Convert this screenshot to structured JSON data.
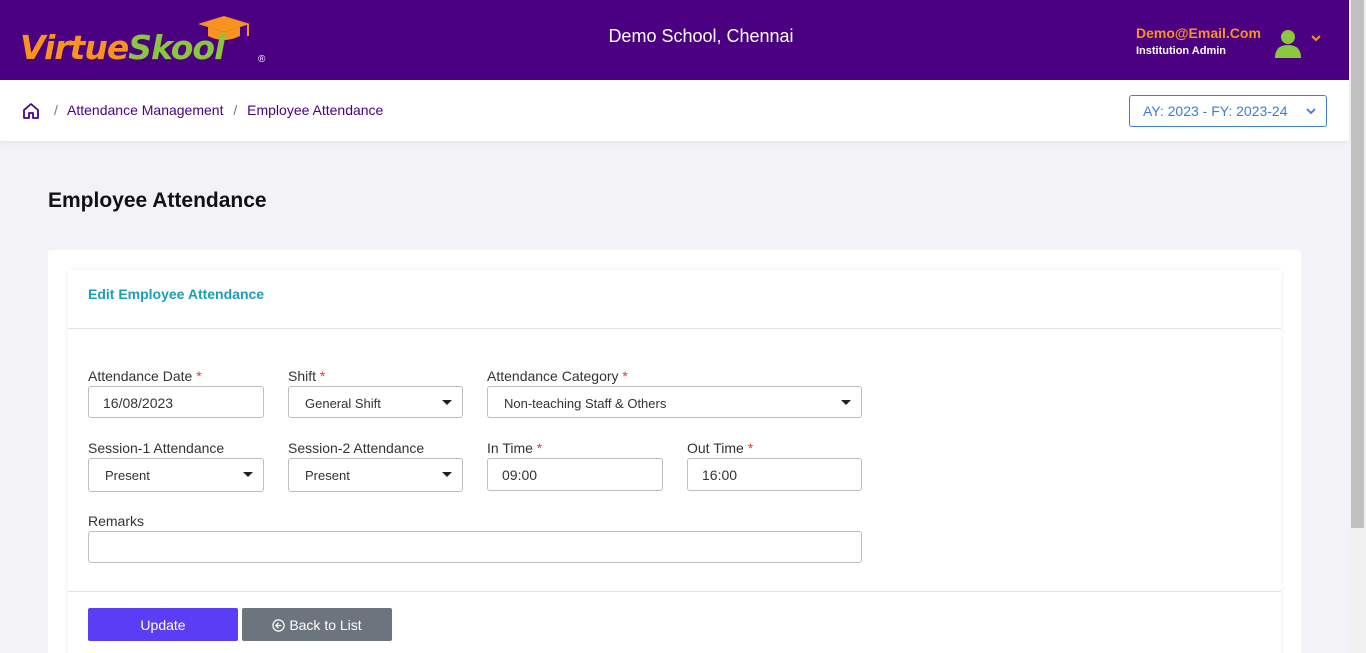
{
  "header": {
    "logo": {
      "part1": "Virtue",
      "part2": "Skool",
      "reg": "®"
    },
    "school_name": "Demo School, Chennai",
    "user_email": "Demo@Email.Com",
    "user_role": "Institution Admin"
  },
  "breadcrumb": {
    "items": [
      "Attendance Management",
      "Employee Attendance"
    ],
    "separator": "/"
  },
  "academic_year": "AY: 2023 - FY: 2023-24",
  "page_title": "Employee Attendance",
  "form": {
    "title": "Edit Employee Attendance",
    "required_mark": "*",
    "attendance_date": {
      "label": "Attendance Date",
      "value": "16/08/2023"
    },
    "shift": {
      "label": "Shift",
      "value": "General Shift"
    },
    "attendance_category": {
      "label": "Attendance Category",
      "value": "Non-teaching Staff & Others"
    },
    "session1": {
      "label": "Session-1 Attendance",
      "value": "Present"
    },
    "session2": {
      "label": "Session-2 Attendance",
      "value": "Present"
    },
    "in_time": {
      "label": "In Time",
      "value": "09:00"
    },
    "out_time": {
      "label": "Out Time",
      "value": "16:00"
    },
    "remarks": {
      "label": "Remarks",
      "value": ""
    },
    "update_label": "Update",
    "back_label": "Back to List"
  },
  "colors": {
    "header_bg": "#4b0082",
    "accent_orange": "#f7931e",
    "accent_green": "#8cc63f",
    "primary_button": "#5a3df5",
    "secondary_button": "#6c757d",
    "card_title": "#1a9fb5"
  }
}
